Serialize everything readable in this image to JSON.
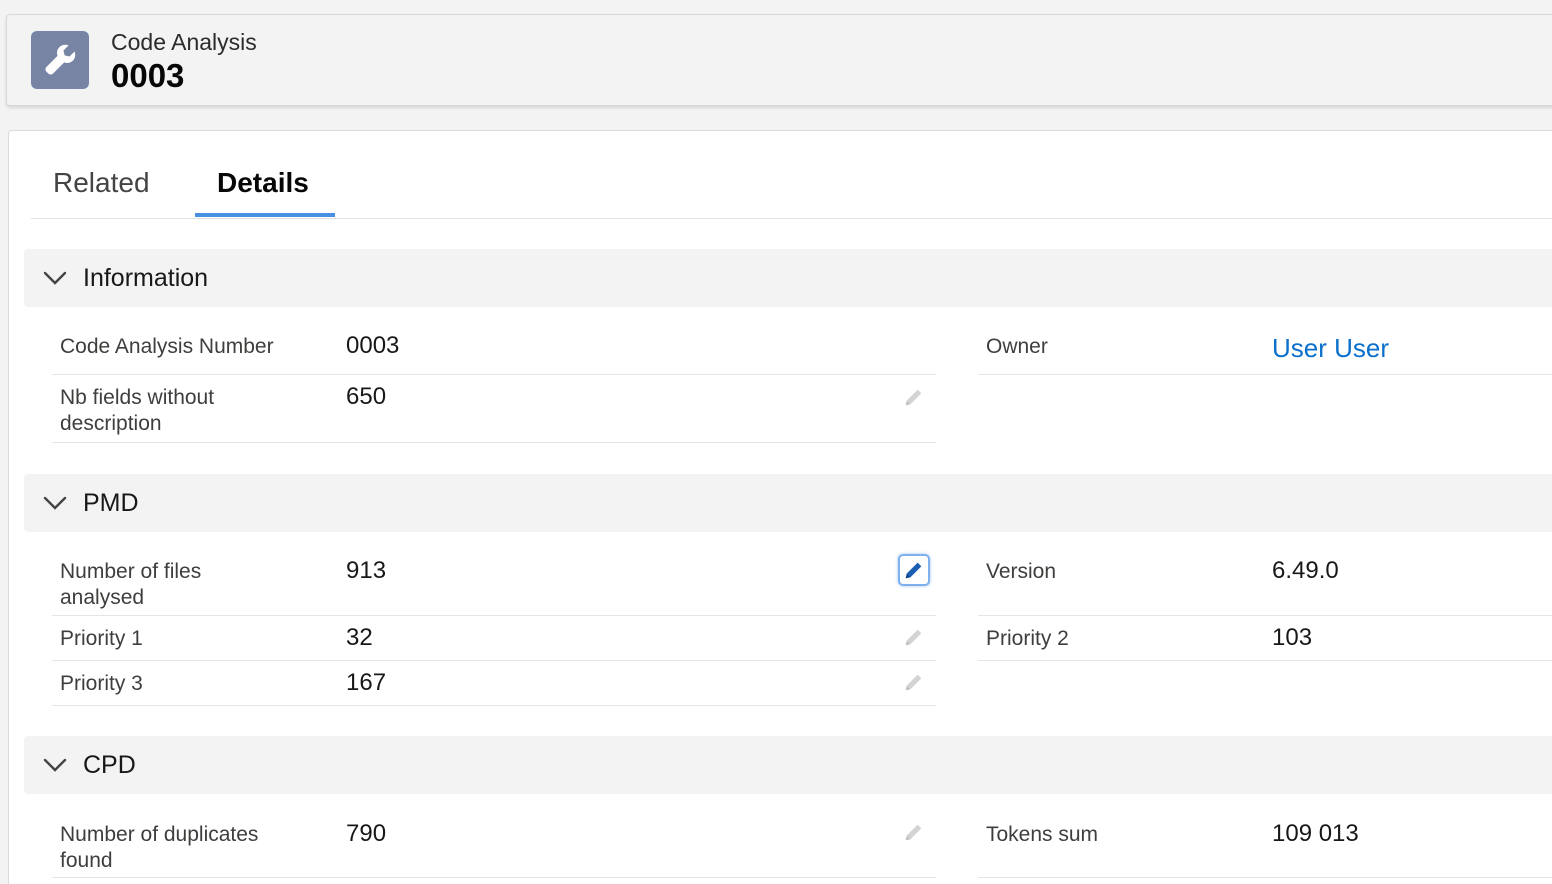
{
  "header": {
    "object_type": "Code Analysis",
    "record_name": "0003",
    "icon": "wrench-icon",
    "icon_bg": "#7784a4"
  },
  "tabs": [
    {
      "label": "Related",
      "active": false
    },
    {
      "label": "Details",
      "active": true
    }
  ],
  "accent_color": "#4a90e2",
  "link_color": "#0b6fcc",
  "sections": {
    "information": {
      "title": "Information",
      "fields": {
        "number": {
          "label": "Code Analysis Number",
          "value": "0003"
        },
        "owner": {
          "label": "Owner",
          "value": "User User"
        },
        "nb_fields": {
          "label": "Nb fields without description",
          "value": "650"
        }
      }
    },
    "pmd": {
      "title": "PMD",
      "fields": {
        "files": {
          "label": "Number of files analysed",
          "value": "913"
        },
        "version": {
          "label": "Version",
          "value": "6.49.0"
        },
        "p1": {
          "label": "Priority 1",
          "value": "32"
        },
        "p2": {
          "label": "Priority 2",
          "value": "103"
        },
        "p3": {
          "label": "Priority 3",
          "value": "167"
        }
      }
    },
    "cpd": {
      "title": "CPD",
      "fields": {
        "duplicates": {
          "label": "Number of duplicates found",
          "value": "790"
        },
        "tokens": {
          "label": "Tokens sum",
          "value": "109 013"
        }
      }
    }
  }
}
